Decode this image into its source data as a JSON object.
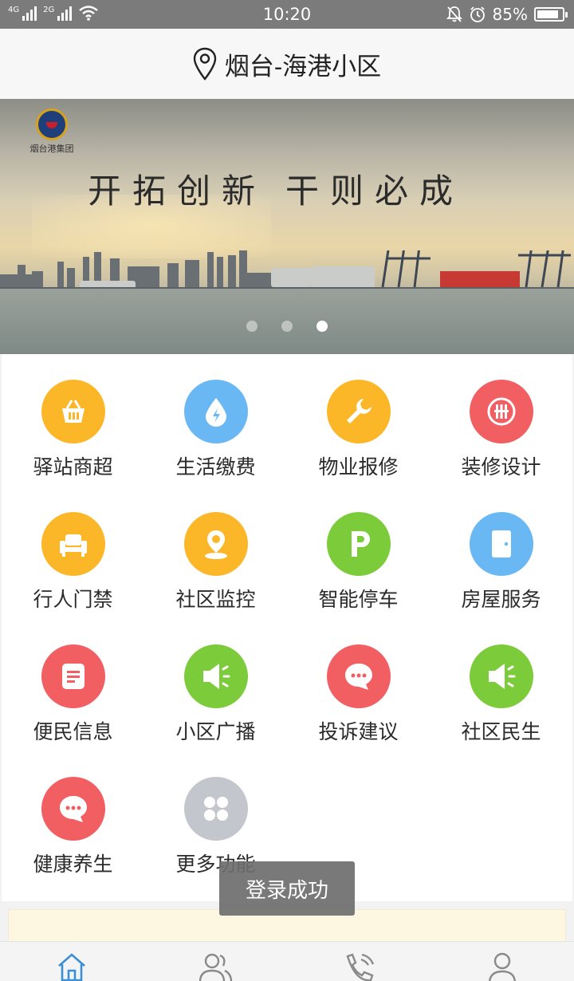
{
  "status_bar": {
    "network_1": "4G",
    "network_2": "2G",
    "time": "10:20",
    "battery": "85%",
    "battery_level": 0.85
  },
  "header": {
    "location_icon": "map-pin-icon",
    "title": "烟台-海港小区"
  },
  "banner": {
    "logo_text": "烟台港集团",
    "slogan_part1": "开拓创新",
    "slogan_part2": "干则必成",
    "active_slide": 3,
    "slide_count": 3
  },
  "services": [
    {
      "label": "驿站商超",
      "icon": "basket-icon",
      "color": "#fbb727"
    },
    {
      "label": "生活缴费",
      "icon": "water-drop-icon",
      "color": "#69b8f3"
    },
    {
      "label": "物业报修",
      "icon": "wrench-icon",
      "color": "#fbb727"
    },
    {
      "label": "装修设计",
      "icon": "brand-circle-icon",
      "color": "#f25f63"
    },
    {
      "label": "行人门禁",
      "icon": "sofa-icon",
      "color": "#fbb727"
    },
    {
      "label": "社区监控",
      "icon": "location-person-icon",
      "color": "#fbb727"
    },
    {
      "label": "智能停车",
      "icon": "parking-icon",
      "color": "#7ccb3b"
    },
    {
      "label": "房屋服务",
      "icon": "door-icon",
      "color": "#69b8f3"
    },
    {
      "label": "便民信息",
      "icon": "document-icon",
      "color": "#f25f63"
    },
    {
      "label": "小区广播",
      "icon": "speaker-icon",
      "color": "#7ccb3b"
    },
    {
      "label": "投诉建议",
      "icon": "chat-bubble-icon",
      "color": "#f25f63"
    },
    {
      "label": "社区民生",
      "icon": "speaker-icon",
      "color": "#7ccb3b"
    },
    {
      "label": "健康养生",
      "icon": "chat-bubble-icon",
      "color": "#f25f63"
    },
    {
      "label": "更多功能",
      "icon": "grid-dots-icon",
      "color": "#c3c6cc"
    }
  ],
  "toast": {
    "text": "登录成功"
  },
  "bottom_nav": [
    {
      "icon": "home-icon",
      "active": true
    },
    {
      "icon": "people-icon",
      "active": false
    },
    {
      "icon": "phone-icon",
      "active": false
    },
    {
      "icon": "user-icon",
      "active": false
    }
  ],
  "colors": {
    "accent": "#3a8fd6",
    "nav_inactive": "#8a8a8a"
  }
}
